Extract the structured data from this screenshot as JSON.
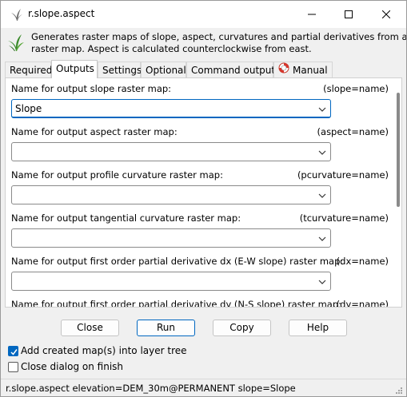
{
  "window": {
    "title": "r.slope.aspect",
    "icon": "grass-leaf-icon"
  },
  "description": {
    "line1": "Generates raster maps of slope, aspect, curvatures and partial derivatives from an elevation",
    "line2": "raster map. Aspect is calculated counterclockwise from east."
  },
  "tabs": [
    {
      "label": "Required"
    },
    {
      "label": "Outputs"
    },
    {
      "label": "Settings"
    },
    {
      "label": "Optional"
    },
    {
      "label": "Command output"
    },
    {
      "label": "Manual"
    }
  ],
  "active_tab": "Outputs",
  "fields": [
    {
      "label": "Name for output slope raster map:",
      "key": "(slope=name)",
      "value": "Slope"
    },
    {
      "label": "Name for output aspect raster map:",
      "key": "(aspect=name)",
      "value": ""
    },
    {
      "label": "Name for output profile curvature raster map:",
      "key": "(pcurvature=name)",
      "value": ""
    },
    {
      "label": "Name for output tangential curvature raster map:",
      "key": "(tcurvature=name)",
      "value": ""
    },
    {
      "label": "Name for output first order partial derivative dx (E-W slope) raster  map:",
      "key": "(dx=name)",
      "value": ""
    },
    {
      "label": "Name for output first order partial derivative dy (N-S slope) raster  map:",
      "key": "(dy=name)",
      "value": ""
    }
  ],
  "buttons": {
    "close": "Close",
    "run": "Run",
    "copy": "Copy",
    "help": "Help"
  },
  "options": {
    "add_to_layer_tree": {
      "label": "Add created map(s) into layer tree",
      "checked": true
    },
    "close_on_finish": {
      "label": "Close dialog on finish",
      "checked": false
    }
  },
  "statusbar": {
    "command": "r.slope.aspect elevation=DEM_30m@PERMANENT slope=Slope"
  },
  "colors": {
    "accent": "#0067c0",
    "grass_green": "#3a8a2a"
  }
}
